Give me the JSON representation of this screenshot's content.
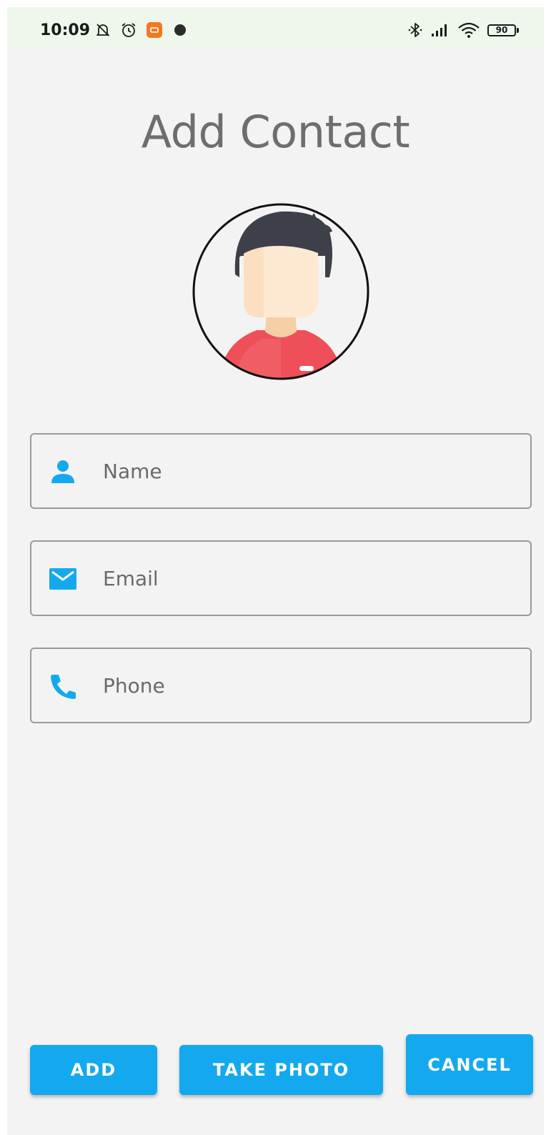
{
  "status_bar": {
    "time": "10:09",
    "battery_level": "90",
    "icons": [
      "muted-bell-icon",
      "alarm-clock-icon",
      "app-notification-icon",
      "dot-icon",
      "bluetooth-icon",
      "signal-icon",
      "wifi-icon",
      "battery-icon"
    ]
  },
  "page": {
    "title": "Add Contact"
  },
  "avatar": {
    "icon": "person-avatar-icon"
  },
  "form": {
    "name": {
      "placeholder": "Name",
      "value": "",
      "icon": "person-icon"
    },
    "email": {
      "placeholder": "Email",
      "value": "",
      "icon": "mail-icon"
    },
    "phone": {
      "placeholder": "Phone",
      "value": "",
      "icon": "phone-icon"
    }
  },
  "actions": {
    "add_label": "ADD",
    "take_photo_label": "TAKE PHOTO",
    "cancel_label": "CANCEL"
  },
  "colors": {
    "accent": "#14a9ee",
    "background": "#f3f3f3",
    "title": "#6e6e6e",
    "field_border": "#9a9a9a",
    "status_bar": "#eff7ec"
  }
}
